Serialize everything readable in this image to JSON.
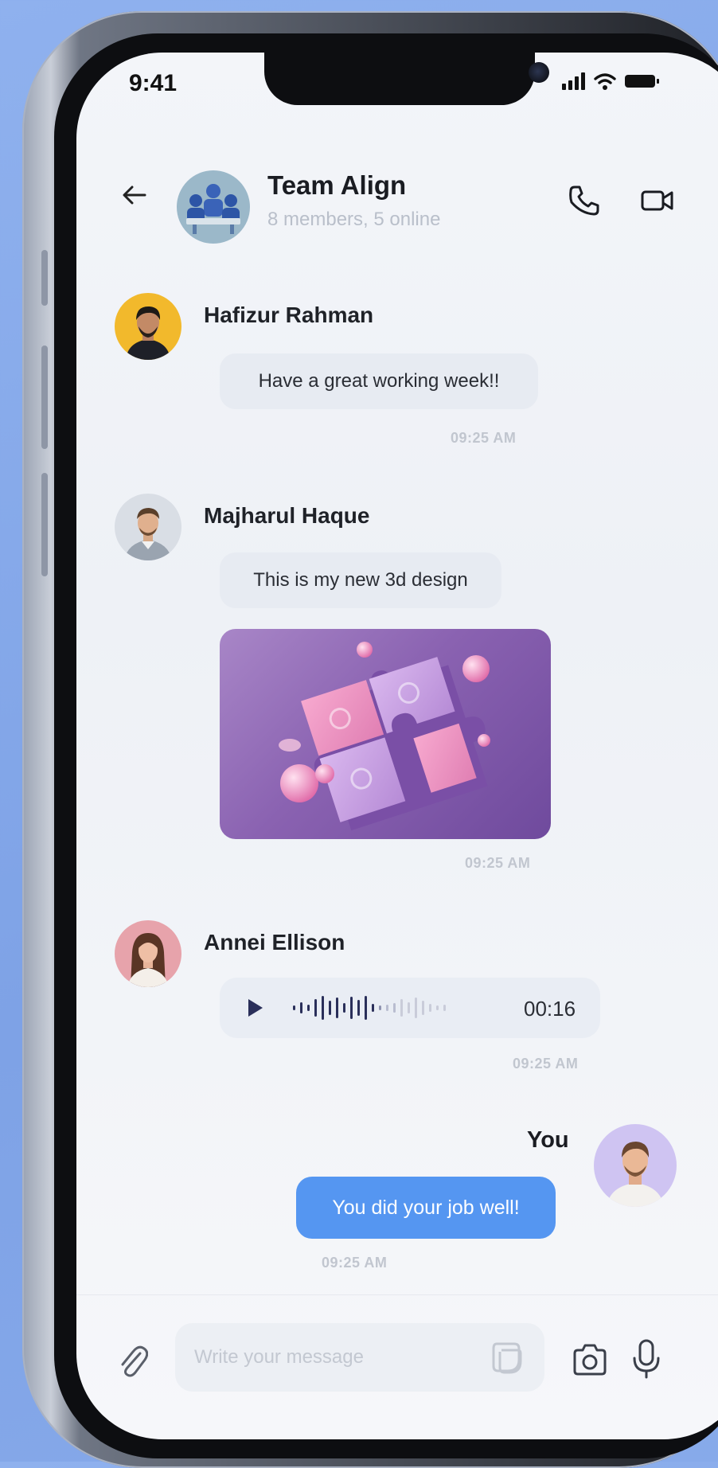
{
  "status": {
    "time": "9:41"
  },
  "header": {
    "title": "Team Align",
    "subtitle": "8 members, 5 online"
  },
  "messages": [
    {
      "sender": "Hafizur Rahman",
      "text": "Have a great working week!!",
      "time": "09:25 AM"
    },
    {
      "sender": "Majharul Haque",
      "text": "This is my new 3d design",
      "time": "09:25 AM",
      "attachment": "puzzle-3d-image"
    },
    {
      "sender": "Annei Ellison",
      "voice_duration": "00:16",
      "time": "09:25 AM"
    },
    {
      "sender": "You",
      "text": "You did your job well!",
      "time": "09:25 AM"
    }
  ],
  "composer": {
    "placeholder": "Write your message"
  },
  "icons": {
    "back": "arrow-left-icon",
    "call": "phone-icon",
    "video": "video-icon",
    "attach": "paperclip-icon",
    "sticker": "sticker-icon",
    "camera": "camera-icon",
    "mic": "microphone-icon"
  },
  "colors": {
    "accent": "#5596f1",
    "bubble_incoming": "#e7ebf2",
    "play_button": "#2a2f5a",
    "background": "#7ea2e6"
  }
}
